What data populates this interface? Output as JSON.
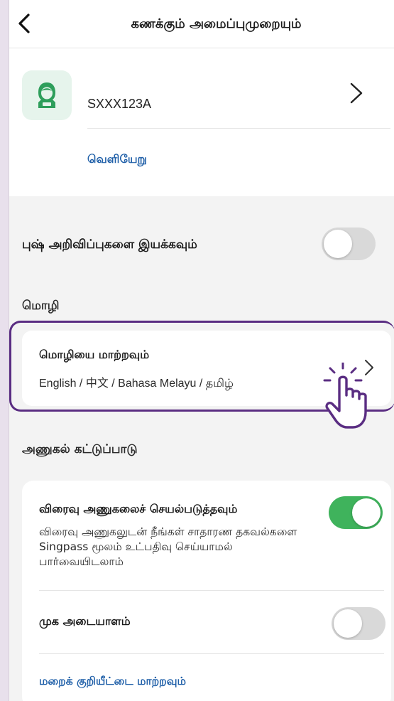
{
  "header": {
    "title": "கணக்கும் அமைப்புமுறையும்"
  },
  "account": {
    "user_id": "SXXX123A",
    "logout_label": "வெளியேறு"
  },
  "notifications": {
    "push_label": "புஷ் அறிவிப்புகளை இயக்கவும்",
    "push_enabled": false
  },
  "language": {
    "section_label": "மொழி",
    "change_title": "மொழியை மாற்றவும்",
    "options_text": "English / 中文 / Bahasa Melayu / தமிழ்"
  },
  "access": {
    "section_label": "அணுகல் கட்டுப்பாடு",
    "quick_access_title": "விரைவு அணுகலைச் செயல்படுத்தவும்",
    "quick_access_desc": "விரைவு அணுகலுடன் நீங்கள் சாதாரண தகவல்களை Singpass மூலம் உட்பதிவு செய்யாமல் பார்வையிடலாம்",
    "quick_access_enabled": true,
    "face_id_label": "முக அடையாளம்",
    "face_id_enabled": false,
    "change_pin_label": "மறைக் குறியீட்டை மாற்றவும்"
  },
  "colors": {
    "accent_link": "#1f5fa8",
    "toggle_on": "#3fb35c",
    "toggle_off": "#d9d9d9",
    "highlight": "#5a2d82",
    "avatar_green": "#2e9e5b"
  },
  "icons": [
    "back-chevron-icon",
    "user-avatar-icon",
    "chevron-right-icon",
    "pointing-hand-icon"
  ]
}
